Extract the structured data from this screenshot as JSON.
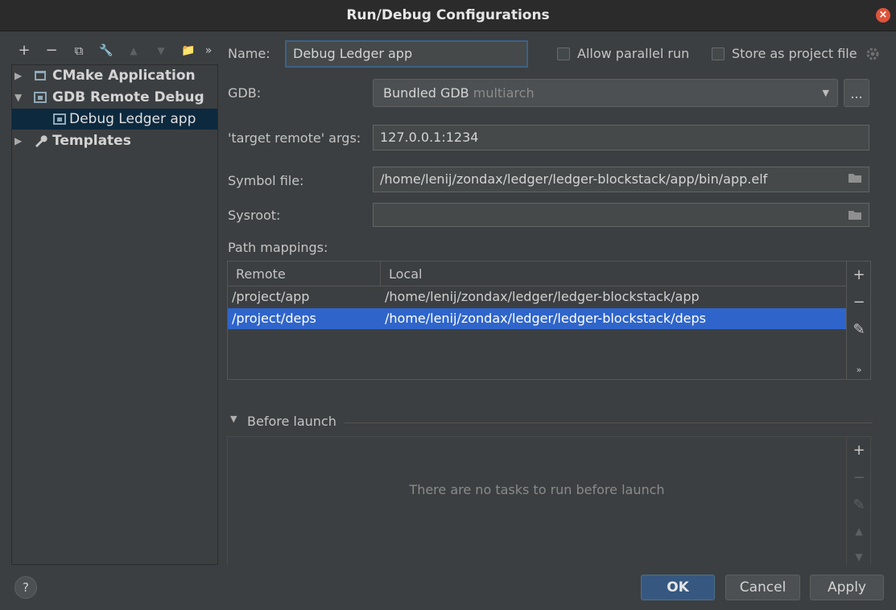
{
  "window": {
    "title": "Run/Debug Configurations"
  },
  "toolbar": {
    "add": "+",
    "remove": "−",
    "copy": "⧉",
    "edit": "🔧",
    "up": "▲",
    "down": "▼",
    "folder": "📁",
    "more": "»"
  },
  "tree": {
    "items": [
      {
        "label": "CMake Application",
        "expanded": false
      },
      {
        "label": "GDB Remote Debug",
        "expanded": true
      },
      {
        "label": "Debug Ledger app",
        "child": true,
        "selected": true
      },
      {
        "label": "Templates",
        "expanded": false
      }
    ]
  },
  "form": {
    "name_label": "Name:",
    "name_value": "Debug Ledger app",
    "allow_parallel_label": "Allow parallel run",
    "store_project_label": "Store as project file",
    "gdb_label": "GDB:",
    "gdb_value": "Bundled GDB",
    "gdb_value_suffix": "multiarch",
    "gdb_more": "...",
    "target_label": "'target remote' args:",
    "target_value": "127.0.0.1:1234",
    "symbol_label": "Symbol file:",
    "symbol_value": "/home/lenij/zondax/ledger/ledger-blockstack/app/bin/app.elf",
    "sysroot_label": "Sysroot:",
    "sysroot_value": "",
    "path_mappings_label": "Path mappings:"
  },
  "path_mappings": {
    "columns": [
      "Remote",
      "Local"
    ],
    "rows": [
      {
        "remote": "/project/app",
        "local": "/home/lenij/zondax/ledger/ledger-blockstack/app"
      },
      {
        "remote": "/project/deps",
        "local": "/home/lenij/zondax/ledger/ledger-blockstack/deps",
        "selected": true
      }
    ],
    "tools": {
      "add": "+",
      "remove": "−",
      "edit": "✎",
      "more": "»"
    }
  },
  "before_launch": {
    "title": "Before launch",
    "empty_text": "There are no tasks to run before launch",
    "tools": {
      "add": "+",
      "remove": "−",
      "edit": "✎",
      "up": "▲",
      "down": "▼"
    }
  },
  "buttons": {
    "help": "?",
    "ok": "OK",
    "cancel": "Cancel",
    "apply": "Apply"
  },
  "colors": {
    "accent": "#2f65ca",
    "primary_button": "#365880",
    "background": "#3c3f41"
  }
}
